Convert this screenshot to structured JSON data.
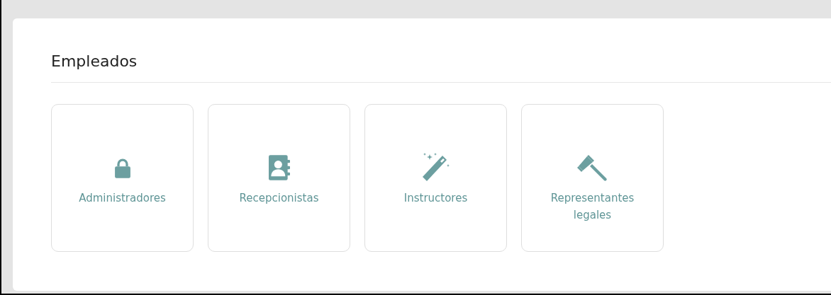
{
  "section": {
    "title": "Empleados"
  },
  "cards": [
    {
      "label": "Administradores",
      "kind": "lock"
    },
    {
      "label": "Recepcionistas",
      "kind": "contacts"
    },
    {
      "label": "Instructores",
      "kind": "wand"
    },
    {
      "label": "Representantes legales",
      "kind": "gavel"
    }
  ]
}
